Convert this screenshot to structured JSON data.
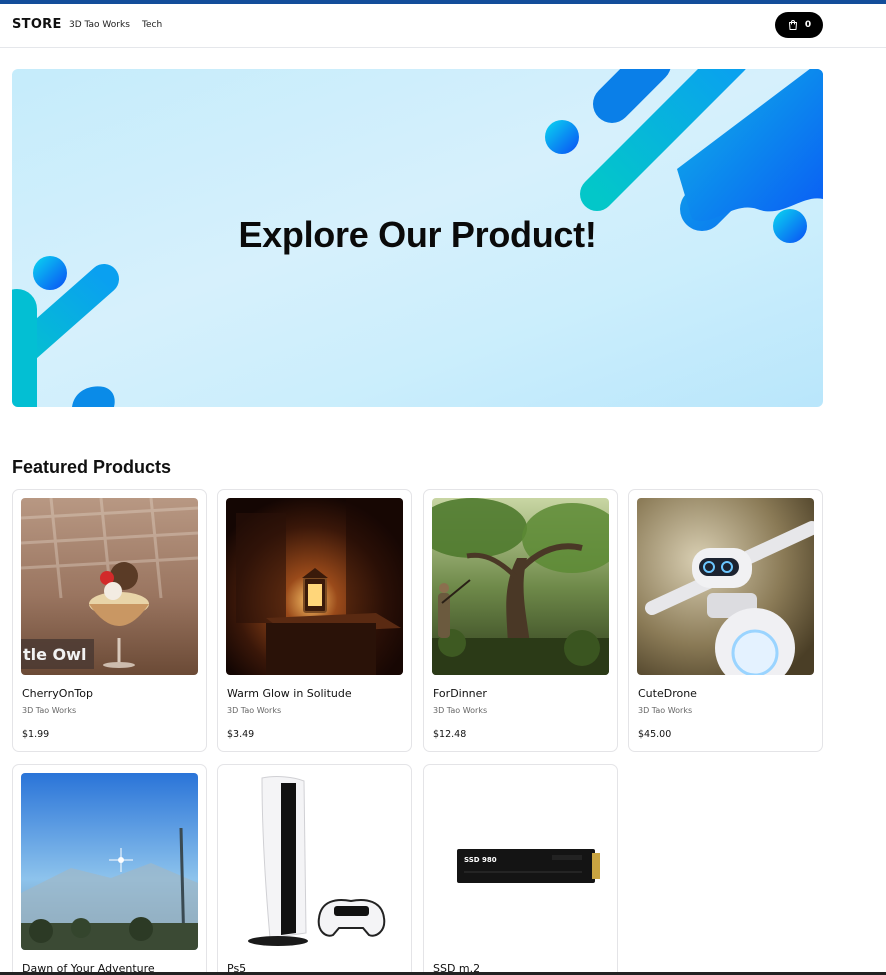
{
  "nav": {
    "brand": "STORE",
    "links": [
      "3D Tao Works",
      "Tech"
    ],
    "cart_count": "0",
    "cart_icon": "shopping-bag-icon"
  },
  "hero": {
    "title": "Explore Our Product!"
  },
  "featured": {
    "title": "Featured Products",
    "products": [
      {
        "name": "CherryOnTop",
        "vendor": "3D Tao Works",
        "price": "$1.99",
        "thumb_text": "tle Owl"
      },
      {
        "name": "Warm Glow in Solitude",
        "vendor": "3D Tao Works",
        "price": "$3.49"
      },
      {
        "name": "ForDinner",
        "vendor": "3D Tao Works",
        "price": "$12.48"
      },
      {
        "name": "CuteDrone",
        "vendor": "3D Tao Works",
        "price": "$45.00"
      },
      {
        "name": "Dawn of Your Adventure"
      },
      {
        "name": "Ps5"
      },
      {
        "name": "SSD m.2",
        "thumb_text": "SSD 980"
      }
    ]
  },
  "colors": {
    "accent_bar": "#134d9a",
    "hero_shape_blue": "#0a6bff",
    "hero_shape_cyan": "#00c6d6"
  }
}
